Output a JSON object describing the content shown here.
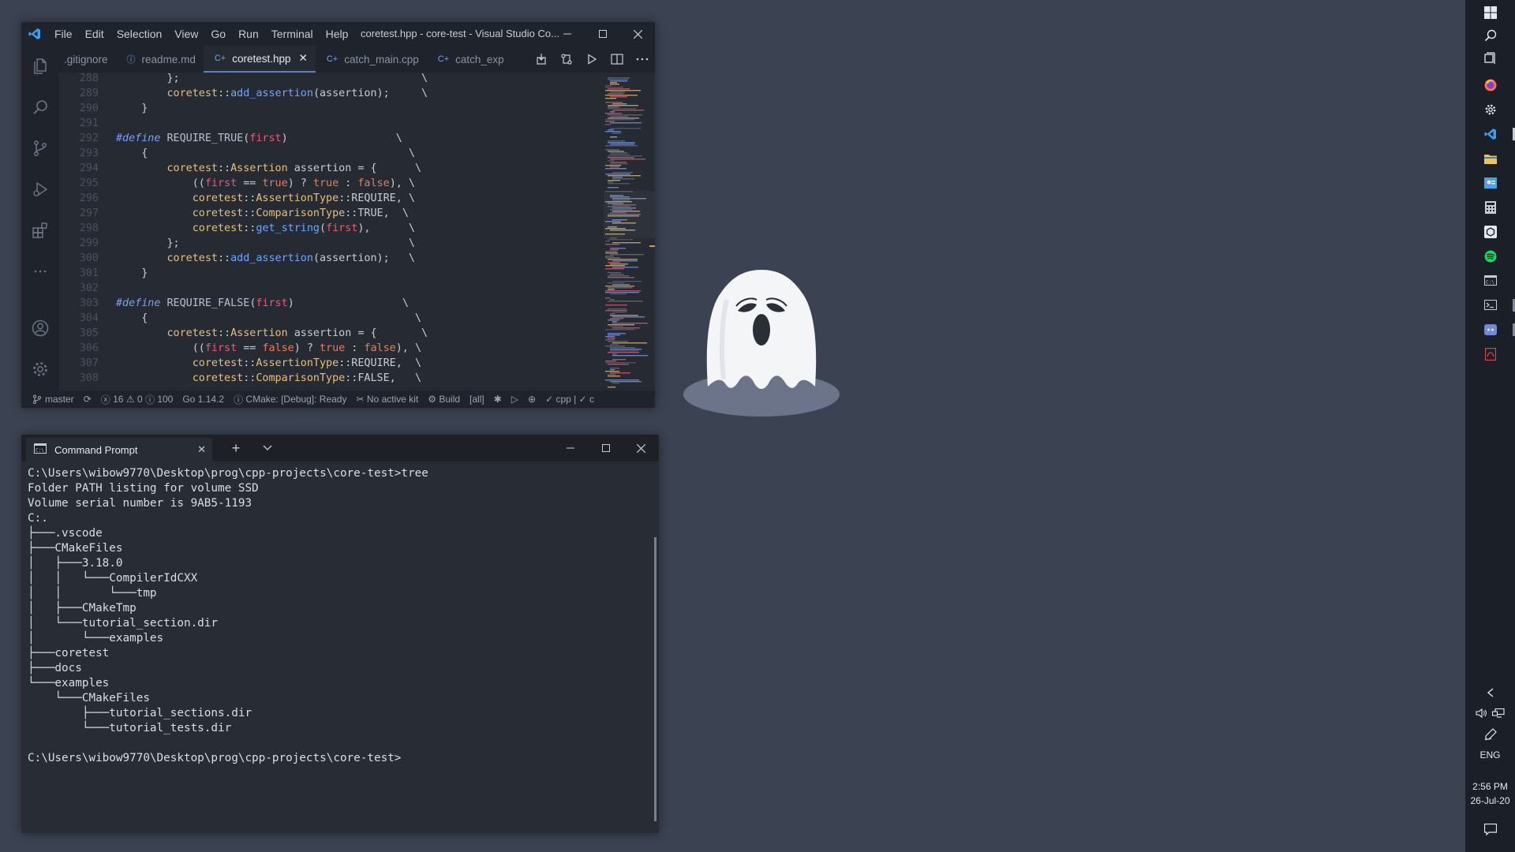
{
  "vscode": {
    "title": "coretest.hpp - core-test - Visual Studio Co...",
    "menu": [
      "File",
      "Edit",
      "Selection",
      "View",
      "Go",
      "Run",
      "Terminal",
      "Help"
    ],
    "tabs": [
      {
        "label": ".gitignore",
        "icon": "gitignore-icon",
        "active": false
      },
      {
        "label": "readme.md",
        "icon": "info-icon",
        "active": false
      },
      {
        "label": "coretest.hpp",
        "icon": "cpp-file-icon",
        "active": true
      },
      {
        "label": "catch_main.cpp",
        "icon": "cpp-file-icon",
        "active": false
      },
      {
        "label": "catch_exp",
        "icon": "cpp-file-icon",
        "active": false
      }
    ],
    "line_numbers": [
      "288",
      "289",
      "290",
      "291",
      "292",
      "293",
      "294",
      "295",
      "296",
      "297",
      "298",
      "299",
      "300",
      "301",
      "302",
      "303",
      "304",
      "305",
      "306",
      "307",
      "308"
    ],
    "status": {
      "branch": "master",
      "errors": "16",
      "warnings": "0",
      "infos": "100",
      "go_version": "Go 1.14.2",
      "cmake": "CMake: [Debug]: Ready",
      "kit": "No active kit",
      "build": "Build",
      "target": "[all]",
      "lang": "cpp | ✓ c"
    }
  },
  "cmd": {
    "tab_label": "Command Prompt",
    "lines": [
      "C:\\Users\\wibow9770\\Desktop\\prog\\cpp-projects\\core-test>tree",
      "Folder PATH listing for volume SSD",
      "Volume serial number is 9AB5-1193",
      "C:.",
      "├───.vscode",
      "├───CMakeFiles",
      "│   ├───3.18.0",
      "│   │   └───CompilerIdCXX",
      "│   │       └───tmp",
      "│   ├───CMakeTmp",
      "│   └───tutorial_section.dir",
      "│       └───examples",
      "├───coretest",
      "├───docs",
      "└───examples",
      "    └───CMakeFiles",
      "        ├───tutorial_sections.dir",
      "        └───tutorial_tests.dir",
      "",
      "C:\\Users\\wibow9770\\Desktop\\prog\\cpp-projects\\core-test>"
    ]
  },
  "taskbar": {
    "language": "ENG",
    "time": "2:56 PM",
    "date": "26-Jul-20"
  },
  "colors": {
    "desktop": "#3b4252",
    "accent": "#5a82d0"
  }
}
